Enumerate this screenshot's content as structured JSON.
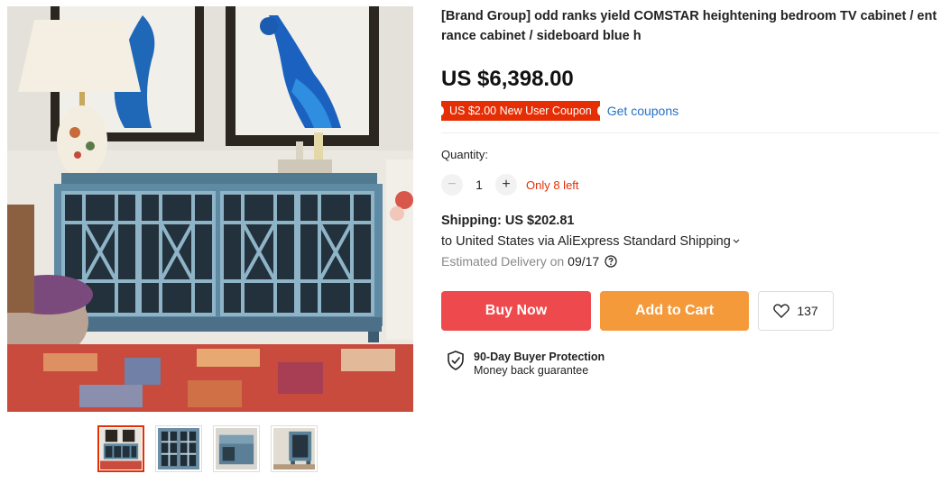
{
  "product": {
    "title": "[Brand Group] odd ranks yield COMSTAR heightening bedroom TV cabinet / entrance cabinet / sideboard blue h",
    "price": "US $6,398.00",
    "coupon_label": "US $2.00 New User Coupon",
    "get_coupons_label": "Get coupons"
  },
  "quantity": {
    "label": "Quantity:",
    "value": "1",
    "minus": "−",
    "plus": "+",
    "stock_note": "Only 8 left"
  },
  "shipping": {
    "title": "Shipping: US $202.81",
    "destination": "to United States via AliExpress Standard Shipping",
    "dropdown_icon": "chevron-down-icon",
    "delivery_prefix": "Estimated Delivery on",
    "delivery_date": "09/17",
    "help_icon": "question-circle-icon"
  },
  "actions": {
    "buy_now": "Buy Now",
    "add_to_cart": "Add to Cart",
    "wishlist_count": "137",
    "wishlist_icon": "heart-icon"
  },
  "protection": {
    "title": "90-Day Buyer Protection",
    "subtitle": "Money back guarantee",
    "icon": "shield-check-icon"
  },
  "gallery": {
    "active_index": 0,
    "thumbnail_count": 4
  },
  "colors": {
    "accent_red": "#e62e04",
    "buy_now": "#ee4a4d",
    "add_to_cart": "#f49a3b",
    "link_blue": "#2672c9"
  }
}
